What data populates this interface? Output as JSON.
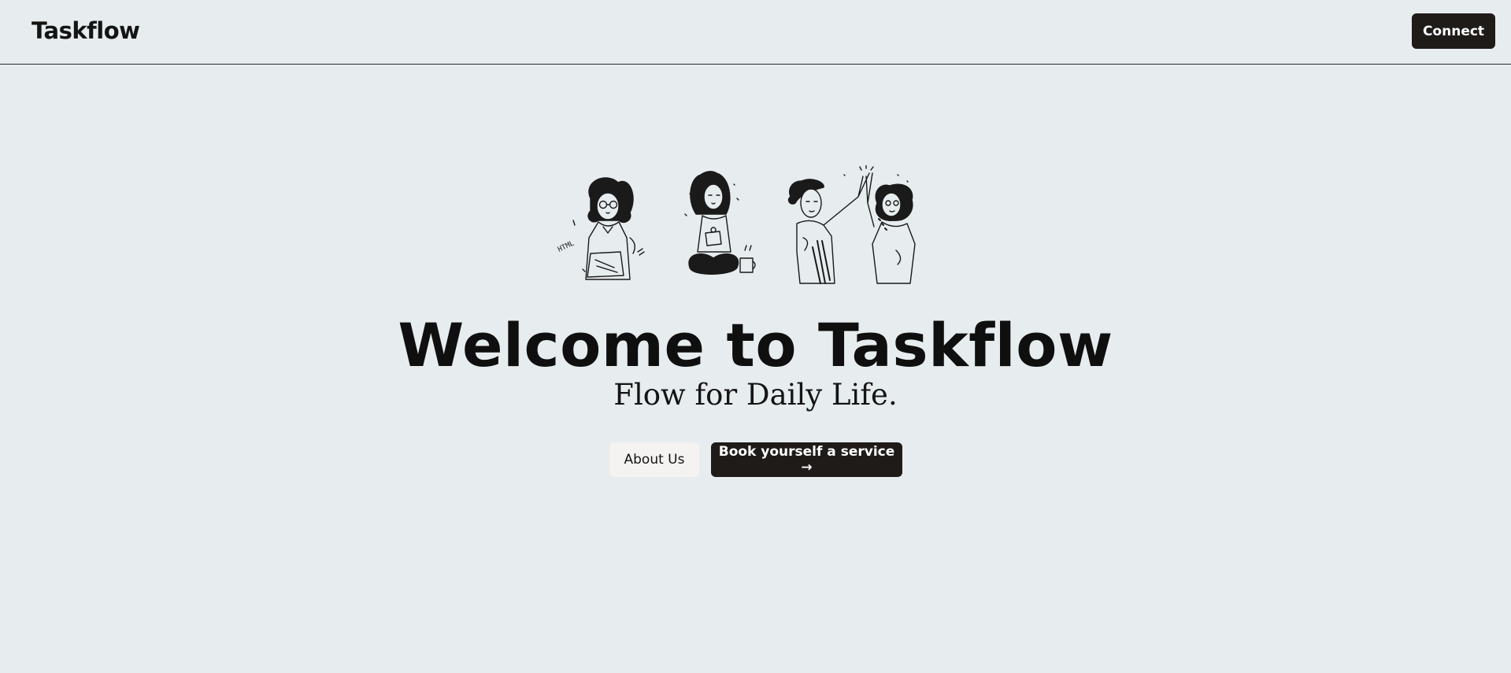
{
  "header": {
    "brand": "Taskflow",
    "connect_label": "Connect"
  },
  "hero": {
    "illustration_icon": "team-collaboration-illustration",
    "illustration_text": "HTML",
    "title": "Welcome to Taskflow",
    "subtitle": "Flow for Daily Life.",
    "about_label": "About Us",
    "book_label": "Book yourself a service →"
  },
  "colors": {
    "background": "#e7ecee",
    "primary_button": "#1e1b19",
    "secondary_button": "#f4f3f1",
    "text": "#141414"
  }
}
